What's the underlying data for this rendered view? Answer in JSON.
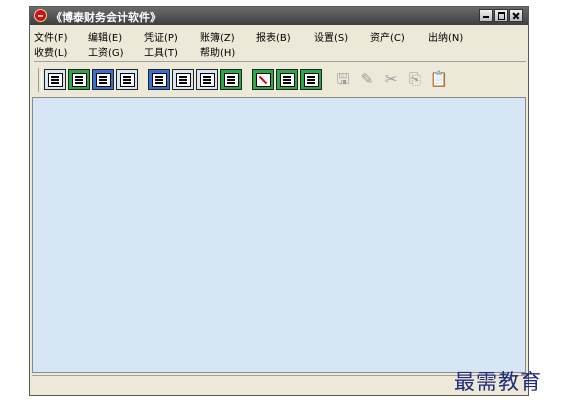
{
  "window": {
    "title": "《博泰财务会计软件》"
  },
  "menus": {
    "file": "文件(F)",
    "edit": "编辑(E)",
    "voucher": "凭证(P)",
    "ledger": "账簿(Z)",
    "report": "报表(B)",
    "settings": "设置(S)",
    "asset": "资产(C)",
    "cashier": "出纳(N)",
    "receipt_fee": "收费(L)",
    "salary": "工资(G)",
    "tools": "工具(T)",
    "help": "帮助(H)"
  },
  "toolbar": {
    "dim_icons": {
      "save": "🖫",
      "edit": "✎",
      "cut": "✂",
      "copy": "⎘",
      "paste": "📋"
    }
  },
  "watermark": "最需教育"
}
